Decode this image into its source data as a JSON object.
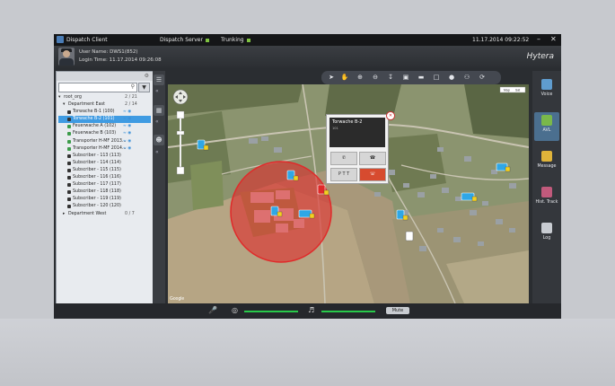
{
  "titlebar": {
    "app_name": "Dispatch Client",
    "dispatch_server_label": "Dispatch Server",
    "trunking_label": "Trunking",
    "datetime": "11.17.2014 09:22:52",
    "minimize": "–",
    "close": "✕"
  },
  "header": {
    "user_name": "User Name: DWS1(852)",
    "login_time": "Login Time: 11.17.2014 09:26:08",
    "logo": "Hytera"
  },
  "tree": [
    {
      "label": "root_org",
      "count": "2 / 21",
      "indent": 0,
      "kind": "org"
    },
    {
      "label": "Department East",
      "count": "2 / 14",
      "indent": 1,
      "kind": "org"
    },
    {
      "label": "Torwache B-1 (100)",
      "indent": 2,
      "kind": "radio",
      "status": "online"
    },
    {
      "label": "Torwache B-2 (101)",
      "indent": 2,
      "kind": "radio",
      "status": "online",
      "selected": true
    },
    {
      "label": "Feuerwache A (102)",
      "indent": 2,
      "kind": "radio_green",
      "status": "online"
    },
    {
      "label": "Feuerwache B (103)",
      "indent": 2,
      "kind": "radio_green",
      "status": "online"
    },
    {
      "label": "Transporter H-MF 2013...",
      "indent": 2,
      "kind": "radio_green",
      "status": "online"
    },
    {
      "label": "Transporter H-MF 2014...",
      "indent": 2,
      "kind": "radio_green",
      "status": "online"
    },
    {
      "label": "Subscriber - 113 (113)",
      "indent": 2,
      "kind": "radio"
    },
    {
      "label": "Subscriber - 114 (114)",
      "indent": 2,
      "kind": "radio"
    },
    {
      "label": "Subscriber - 115 (115)",
      "indent": 2,
      "kind": "radio"
    },
    {
      "label": "Subscriber - 116 (116)",
      "indent": 2,
      "kind": "radio"
    },
    {
      "label": "Subscriber - 117 (117)",
      "indent": 2,
      "kind": "radio"
    },
    {
      "label": "Subscriber - 118 (118)",
      "indent": 2,
      "kind": "radio"
    },
    {
      "label": "Subscriber - 119 (119)",
      "indent": 2,
      "kind": "radio"
    },
    {
      "label": "Subscriber - 120 (120)",
      "indent": 2,
      "kind": "radio"
    },
    {
      "label": "Department West",
      "count": "0 / 7",
      "indent": 1,
      "kind": "org"
    }
  ],
  "popup": {
    "title": "Torwache B-2",
    "subtitle": "101",
    "ptt_label": "P T T"
  },
  "map": {
    "map_type_labels": [
      "Map",
      "Sat"
    ],
    "attribution": "Google"
  },
  "rightbar": [
    {
      "label": "Voice",
      "icon": "voice-icon",
      "color": "#5f9ccf"
    },
    {
      "label": "AVL",
      "icon": "avl-icon",
      "color": "#7ab84a",
      "active": true
    },
    {
      "label": "Message",
      "icon": "message-icon",
      "color": "#e0b43a"
    },
    {
      "label": "Hist. Track",
      "icon": "hist-track-icon",
      "color": "#c15a7c"
    },
    {
      "label": "Log",
      "icon": "log-icon",
      "color": "#c8ccd2"
    }
  ],
  "bottombar": {
    "mute_label": "Mute",
    "mic_level": 0.75,
    "speaker_level": 0.75
  },
  "colors": {
    "accent_blue": "#3f9be2",
    "status_green": "#7fc241",
    "geofence_red": "#e02a2a",
    "ptt_red": "#d74b2f"
  }
}
